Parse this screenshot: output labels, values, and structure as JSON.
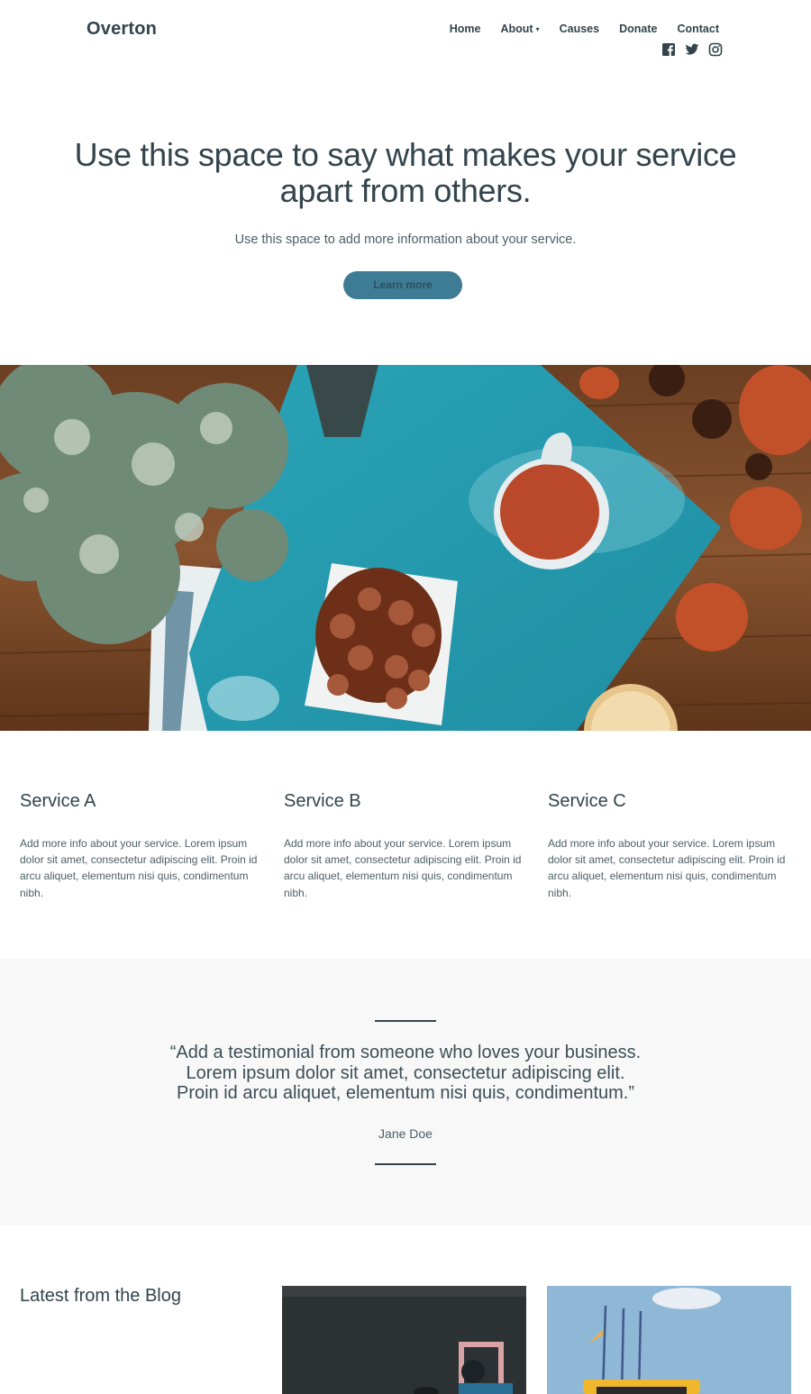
{
  "brand": "Overton",
  "nav": {
    "home": "Home",
    "about": "About",
    "about_caret": "▾",
    "causes": "Causes",
    "donate": "Donate",
    "contact": "Contact"
  },
  "social": [
    "facebook-icon",
    "twitter-icon",
    "instagram-icon"
  ],
  "hero": {
    "title_line1": "Use this space to say what makes your service",
    "title_line2": "apart from others.",
    "subtitle": "Use this space to add more information about your service.",
    "button": "Learn more"
  },
  "services": [
    {
      "title": "Service A",
      "body": "Add more info about your service. Lorem ipsum dolor sit amet, consectetur adipiscing elit. Proin id arcu aliquet, elementum nisi quis, condimentum nibh."
    },
    {
      "title": "Service B",
      "body": "Add more info about your service. Lorem ipsum dolor sit amet, consectetur adipiscing elit. Proin id arcu aliquet, elementum nisi quis, condimentum nibh."
    },
    {
      "title": "Service C",
      "body": "Add more info about your service. Lorem ipsum dolor sit amet, consectetur adipiscing elit. Proin id arcu aliquet, elementum nisi quis, condimentum nibh."
    }
  ],
  "testimonial": {
    "line1": "“Add a testimonial from someone who loves your business.",
    "line2": "Lorem ipsum dolor sit amet, consectetur adipiscing elit.",
    "line3": "Proin id arcu aliquet, elementum nisi quis, condimentum.”",
    "author": "Jane Doe"
  },
  "blog": {
    "title": "Latest from the Blog"
  },
  "colors": {
    "text": "#33444c",
    "button": "#3e7b94",
    "testimonial_bg": "#f8f8f8"
  }
}
